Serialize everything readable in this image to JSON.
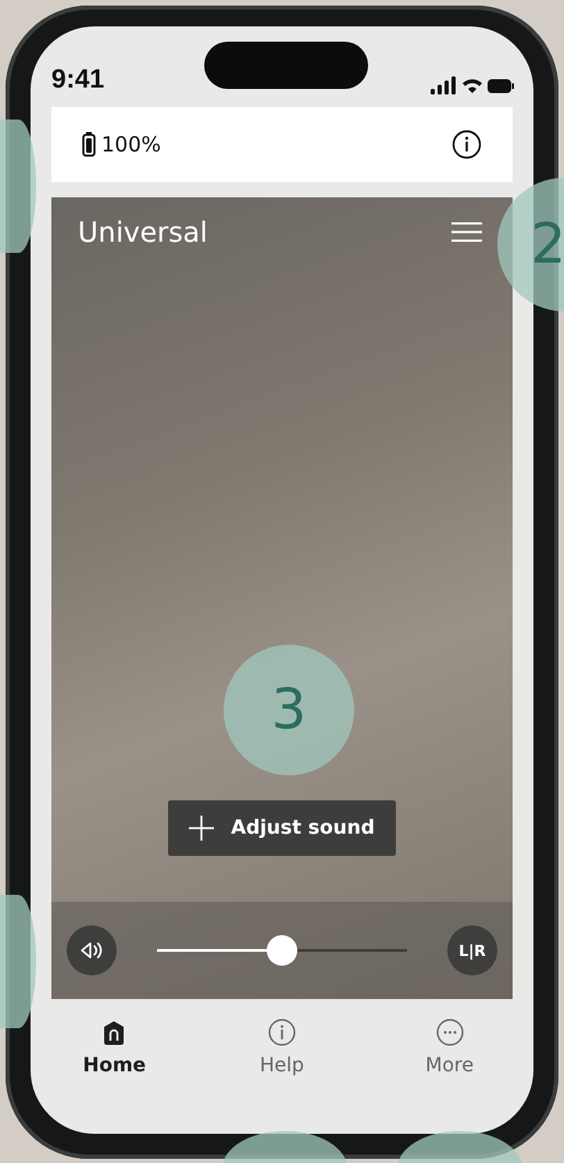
{
  "status_bar": {
    "time": "9:41"
  },
  "header": {
    "battery_text": "100%"
  },
  "program": {
    "title": "Universal",
    "adjust_button": "Adjust sound",
    "volume": {
      "level": 0.5
    },
    "balance_button": "L|R"
  },
  "nav": [
    {
      "label": "Home",
      "kind": "home",
      "selected": true
    },
    {
      "label": "Help",
      "kind": "info",
      "selected": false
    },
    {
      "label": "More",
      "kind": "more",
      "selected": false
    }
  ],
  "callouts": [
    {
      "label": "2"
    },
    {
      "label": "3"
    }
  ]
}
